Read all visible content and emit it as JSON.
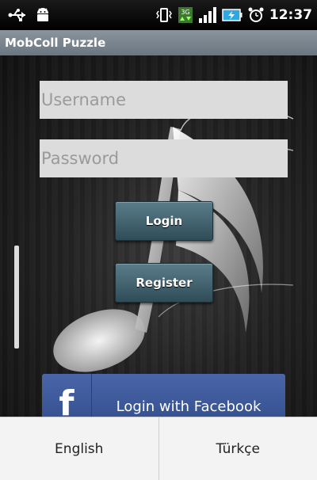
{
  "status_bar": {
    "time": "12:37",
    "icons": [
      "usb-icon",
      "android-debug-icon",
      "vibrate-icon",
      "3g-data-icon",
      "signal-icon",
      "battery-charging-icon",
      "alarm-icon"
    ]
  },
  "app": {
    "title": "MobColl Puzzle"
  },
  "login_form": {
    "username_placeholder": "Username",
    "password_placeholder": "Password",
    "login_label": "Login",
    "register_label": "Register",
    "facebook_logo": "f",
    "facebook_label": "Login with Facebook"
  },
  "language_bar": {
    "options": [
      "English",
      "Türkçe"
    ]
  },
  "colors": {
    "title_bar": "#7f8992",
    "button": "#3d5e6a",
    "facebook": "#3b5998",
    "input_bg": "#dcdcdc",
    "language_bar_bg": "#f3f3f3"
  }
}
